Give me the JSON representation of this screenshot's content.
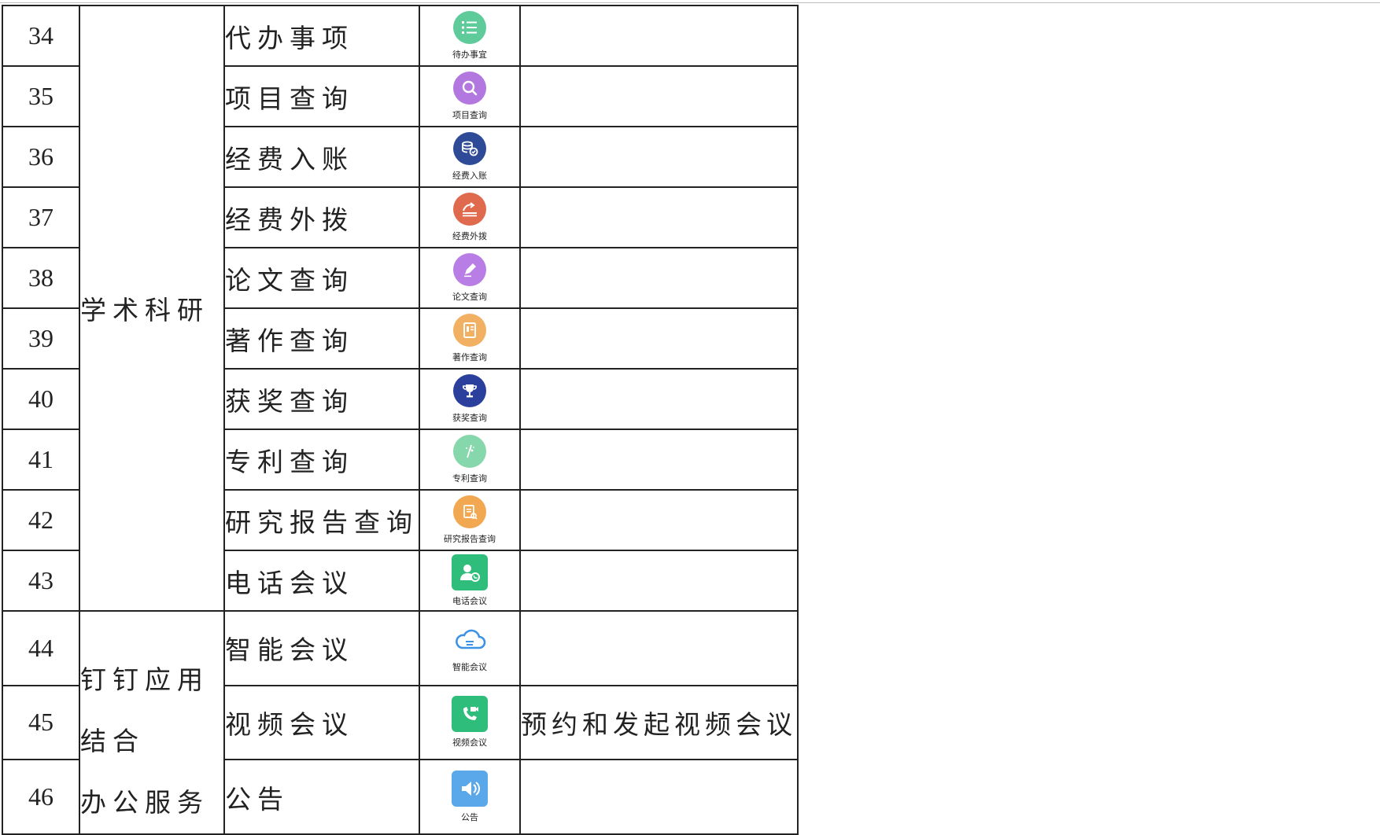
{
  "colors": {
    "mint": "#5fcb9a",
    "violet": "#b377e0",
    "navy": "#2f4b97",
    "coral": "#e06a4e",
    "lilac": "#b97ee6",
    "amber": "#f1b062",
    "royal": "#2b3f9c",
    "paleGreen": "#86d7ab",
    "orange": "#f2a850",
    "green": "#2fbd7c",
    "blue": "#3b92e6",
    "skyblue": "#5aa7ea"
  },
  "categories": {
    "academic": "学术科研",
    "dingtalk_lines": [
      "钉钉应用",
      "结合",
      "办公服务"
    ]
  },
  "rows": [
    {
      "num": "34",
      "name": "代办事项",
      "caption": "待办事宜",
      "icon": "todo-list-icon",
      "desc": ""
    },
    {
      "num": "35",
      "name": "项目查询",
      "caption": "项目查询",
      "icon": "search-icon",
      "desc": ""
    },
    {
      "num": "36",
      "name": "经费入账",
      "caption": "经费入账",
      "icon": "coins-icon",
      "desc": ""
    },
    {
      "num": "37",
      "name": "经费外拨",
      "caption": "经费外拨",
      "icon": "transfer-icon",
      "desc": ""
    },
    {
      "num": "38",
      "name": "论文查询",
      "caption": "论文查询",
      "icon": "pen-icon",
      "desc": ""
    },
    {
      "num": "39",
      "name": "著作查询",
      "caption": "著作查询",
      "icon": "book-icon",
      "desc": ""
    },
    {
      "num": "40",
      "name": "获奖查询",
      "caption": "获奖查询",
      "icon": "trophy-icon",
      "desc": ""
    },
    {
      "num": "41",
      "name": "专利查询",
      "caption": "专利查询",
      "icon": "patent-icon",
      "desc": ""
    },
    {
      "num": "42",
      "name": "研究报告查询",
      "caption": "研究报告查询",
      "icon": "report-icon",
      "desc": ""
    },
    {
      "num": "43",
      "name": "电话会议",
      "caption": "电话会议",
      "icon": "phone-contact-icon",
      "desc": ""
    },
    {
      "num": "44",
      "name": "智能会议",
      "caption": "智能会议",
      "icon": "cloud-icon",
      "desc": ""
    },
    {
      "num": "45",
      "name": "视频会议",
      "caption": "视频会议",
      "icon": "video-call-icon",
      "desc": "预约和发起视频会议"
    },
    {
      "num": "46",
      "name": "公告",
      "caption": "公告",
      "icon": "speaker-icon",
      "desc": ""
    }
  ]
}
